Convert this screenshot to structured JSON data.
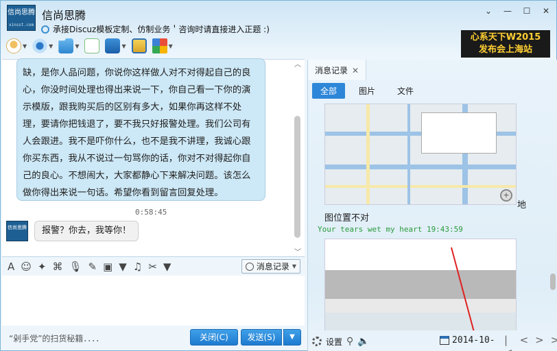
{
  "contact": {
    "name": "信尚思腾",
    "avatar_text": "信尚思腾",
    "avatar_sub": "xinsst.com",
    "signature": "承接Discuz模板定制、仿制业务＇咨询时请直接进入正题 :)"
  },
  "ad_banner": {
    "line1": "心系天下W2015",
    "line2": "发布会上海站"
  },
  "toolbar": {
    "icons": [
      "mic-icon",
      "camera-icon",
      "file-transfer-icon",
      "app-add-icon",
      "remote-desktop-icon",
      "screen-share-icon",
      "apps-grid-icon"
    ]
  },
  "chat": {
    "message_text": "缺，是你人品问题，你说你这样做人对不对得起自己的良心，你没时间处理也得出来说一下，你自己看一下你的演示模版，跟我购买后的区别有多大，如果你再这样不处理，要请你把钱退了，要不我只好报警处理。我们公司有人会跟进。我不是吓你什么，也不是我不讲理，我诚心跟你买东西，我从不说过一句骂你的话，你对不对得起你自己的良心。不想闹大，大家都静心下来解决问题。该怎么做你得出来说一句话。希望你看到留言回复处理。",
    "time": "0:58:45",
    "reply_avatar_text": "信尚思腾",
    "reply_text": "报警？你去，我等你！"
  },
  "editor": {
    "history_button": "消息记录"
  },
  "bottom": {
    "ad_text": "“剁手党”的扫货秘籍．．．．",
    "close_label": "关闭(C)",
    "send_label": "发送(S)"
  },
  "side_panel": {
    "tab_label": "消息记录",
    "filters": [
      "全部",
      "图片",
      "文件"
    ],
    "map_caption": "图位置不对",
    "map_caption_right": "地",
    "sender_line": "Your tears wet my heart 19:43:59",
    "settings_label": "设置",
    "date": "2014-10-"
  }
}
